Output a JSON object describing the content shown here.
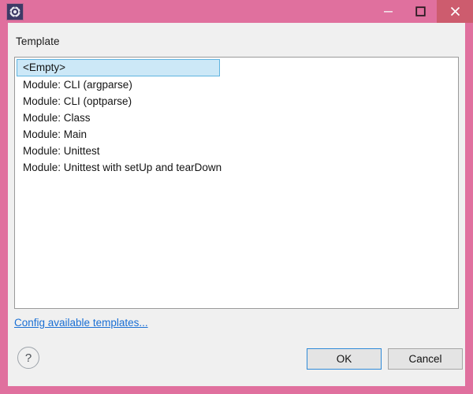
{
  "window": {
    "icon": "gear-icon",
    "title": "",
    "controls": {
      "minimize": "minimize-icon",
      "maximize": "maximize-icon",
      "close": "close-icon"
    },
    "colors": {
      "titlebar": "#e0709e",
      "close_button": "#cd5c6e",
      "dialog_background": "#f0f0f0",
      "selection": "#cce8f7",
      "selection_border": "#5fb3e0",
      "link": "#1a6fd4",
      "focus_border": "#2f8ad8"
    }
  },
  "dialog": {
    "section_label": "Template",
    "template_list": [
      {
        "label": "<Empty>",
        "selected": true
      },
      {
        "label": "Module: CLI (argparse)",
        "selected": false
      },
      {
        "label": "Module: CLI (optparse)",
        "selected": false
      },
      {
        "label": "Module: Class",
        "selected": false
      },
      {
        "label": "Module: Main",
        "selected": false
      },
      {
        "label": "Module: Unittest",
        "selected": false
      },
      {
        "label": "Module: Unittest with setUp and tearDown",
        "selected": false
      }
    ],
    "config_link": "Config available templates...",
    "help_label": "?",
    "buttons": {
      "ok": "OK",
      "cancel": "Cancel"
    }
  }
}
